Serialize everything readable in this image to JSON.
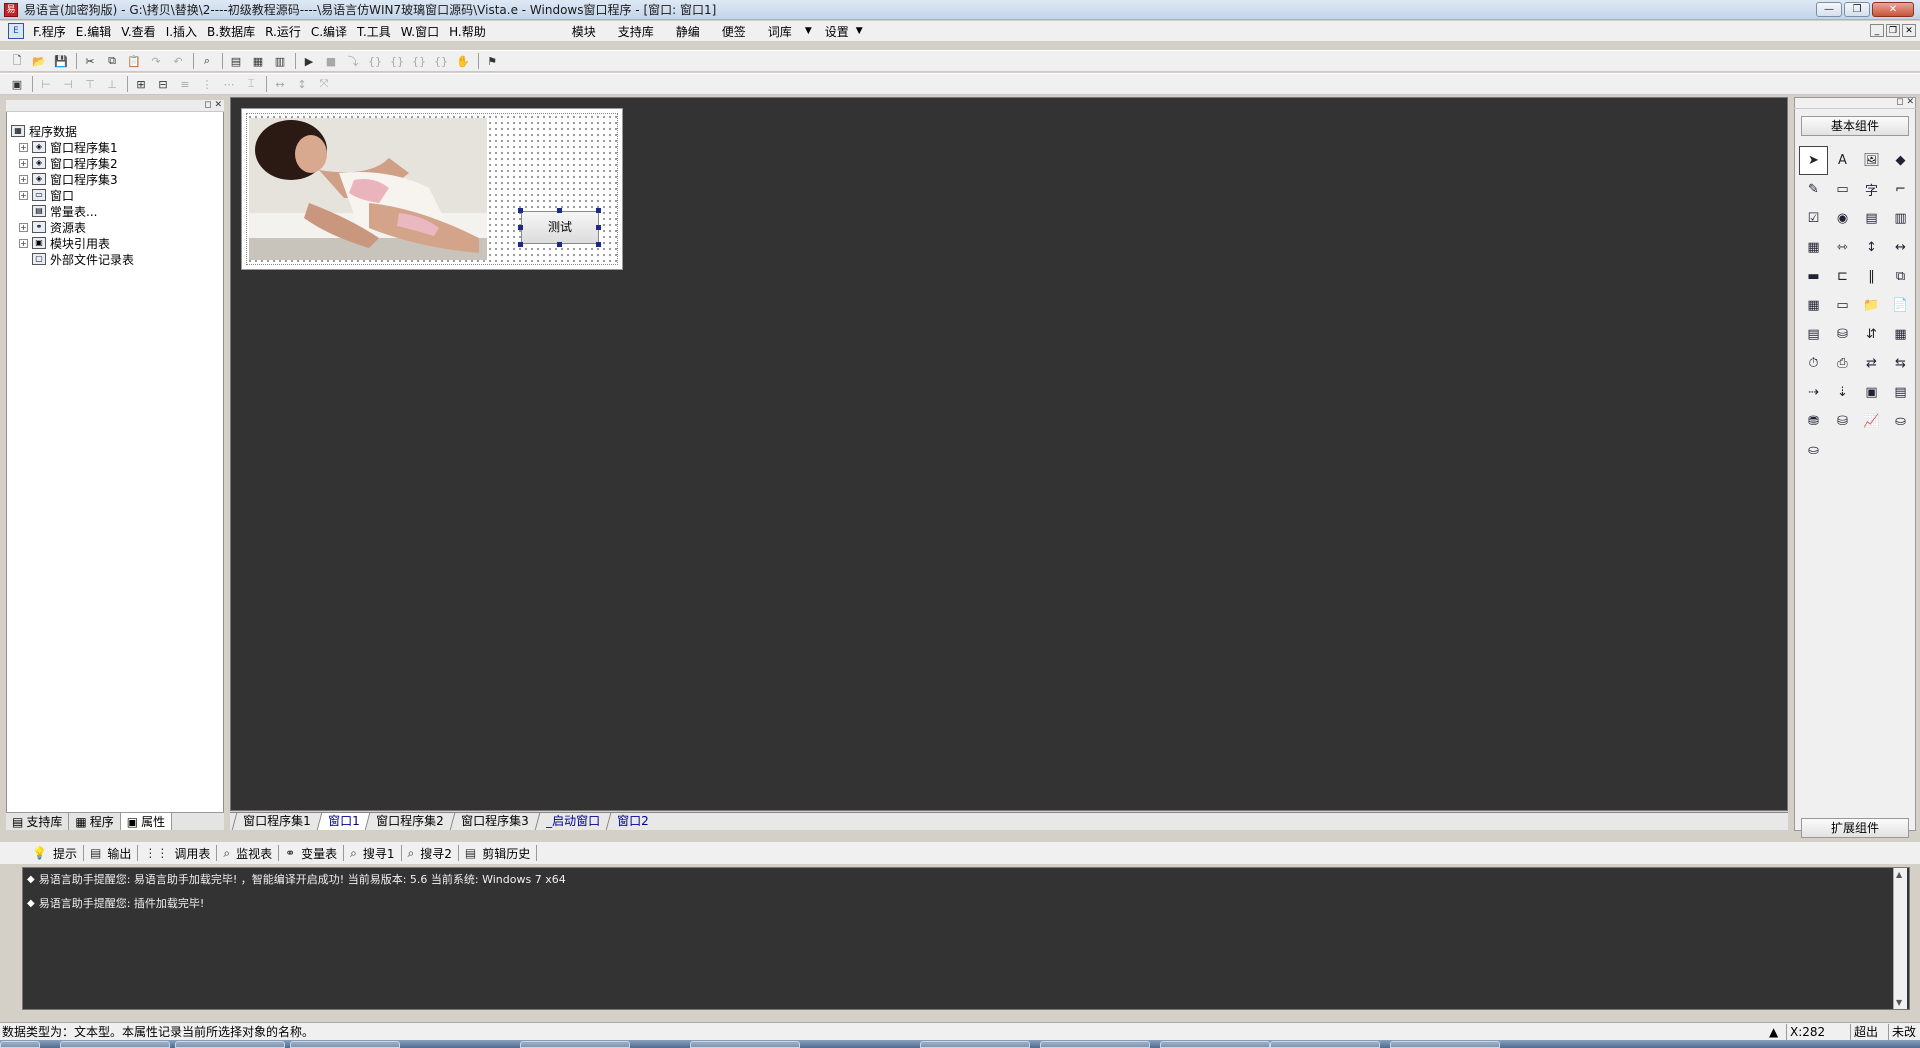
{
  "window": {
    "title": "易语言(加密狗版) - G:\\拷贝\\替换\\2----初级教程源码----\\易语言仿WIN7玻璃窗口源码\\Vista.e - Windows窗口程序 - [窗口: 窗口1]",
    "buttons": {
      "minimize": "—",
      "restore": "❐",
      "close": "✕"
    }
  },
  "menu": {
    "items": [
      "F.程序",
      "E.编辑",
      "V.查看",
      "I.插入",
      "B.数据库",
      "R.运行",
      "C.编译",
      "T.工具",
      "W.窗口",
      "H.帮助"
    ],
    "right_items": [
      "模块",
      "支持库",
      "静编",
      "便签",
      "词库",
      "设置"
    ],
    "mdi_buttons": [
      "_",
      "❐",
      "✕"
    ]
  },
  "left_panel": {
    "tree": [
      {
        "label": "程序数据",
        "level": 0,
        "expander": "",
        "icon": "program-data-icon"
      },
      {
        "label": "窗口程序集1",
        "level": 1,
        "expander": "+",
        "icon": "module-icon"
      },
      {
        "label": "窗口程序集2",
        "level": 1,
        "expander": "+",
        "icon": "module-icon"
      },
      {
        "label": "窗口程序集3",
        "level": 1,
        "expander": "+",
        "icon": "module-icon"
      },
      {
        "label": "窗口",
        "level": 1,
        "expander": "+",
        "icon": "window-icon"
      },
      {
        "label": "常量表...",
        "level": 1,
        "expander": "",
        "icon": "constants-icon"
      },
      {
        "label": "资源表",
        "level": 1,
        "expander": "+",
        "icon": "resources-icon"
      },
      {
        "label": "模块引用表",
        "level": 1,
        "expander": "+",
        "icon": "module-ref-icon"
      },
      {
        "label": "外部文件记录表",
        "level": 1,
        "expander": "",
        "icon": "file-record-icon"
      }
    ],
    "tabs": [
      {
        "label": "支持库",
        "active": false
      },
      {
        "label": "程序",
        "active": false
      },
      {
        "label": "属性",
        "active": true
      }
    ]
  },
  "design": {
    "button_label": "测试",
    "tabs": [
      {
        "label": "窗口程序集1",
        "state": "normal"
      },
      {
        "label": "窗口1",
        "state": "active"
      },
      {
        "label": "窗口程序集2",
        "state": "normal"
      },
      {
        "label": "窗口程序集3",
        "state": "normal"
      },
      {
        "label": "_启动窗口",
        "state": "link"
      },
      {
        "label": "窗口2",
        "state": "link"
      }
    ]
  },
  "components": {
    "basic_label": "基本组件",
    "extended_label": "扩展组件"
  },
  "output": {
    "tabs": [
      "提示",
      "输出",
      "调用表",
      "监视表",
      "变量表",
      "搜寻1",
      "搜寻2",
      "剪辑历史"
    ],
    "lines": [
      "易语言助手提醒您: 易语言助手加载完毕!  ，智能编译开启成功!  当前易版本: 5.6  当前系统: Windows 7 x64",
      "易语言助手提醒您: 插件加载完毕!"
    ]
  },
  "status": {
    "text": "数据类型为：文本型。本属性记录当前所选择对象的名称。",
    "coords": "X:282",
    "cell2": "超出",
    "cell3": "未改"
  }
}
